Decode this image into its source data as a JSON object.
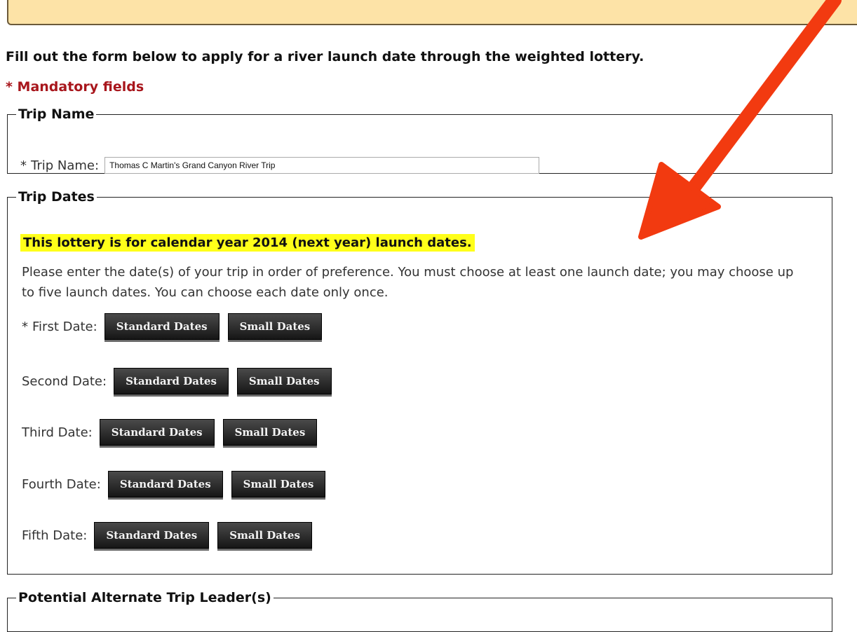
{
  "intro_text": "Fill out the form below to apply for a river launch date through the weighted lottery.",
  "mandatory_note": "* Mandatory fields",
  "trip_name_section": {
    "legend": "Trip Name",
    "required_mark": "*",
    "label": "Trip Name:",
    "value": "Thomas C Martin's Grand Canyon River Trip"
  },
  "trip_dates_section": {
    "legend": "Trip Dates",
    "highlight": "This lottery is for calendar year 2014 (next year) launch dates.",
    "instructions": "Please enter the date(s) of your trip in order of preference. You must choose at least one launch date; you may choose up to five launch dates. You can choose each date only once.",
    "required_mark": "*",
    "rows": [
      {
        "label": "First Date:",
        "standard": "Standard Dates",
        "small": "Small Dates"
      },
      {
        "label": "Second Date:",
        "standard": "Standard Dates",
        "small": "Small Dates"
      },
      {
        "label": "Third Date:",
        "standard": "Standard Dates",
        "small": "Small Dates"
      },
      {
        "label": "Fourth Date:",
        "standard": "Standard Dates",
        "small": "Small Dates"
      },
      {
        "label": "Fifth Date:",
        "standard": "Standard Dates",
        "small": "Small Dates"
      }
    ]
  },
  "alternate_section": {
    "legend": "Potential Alternate Trip Leader(s)"
  },
  "colors": {
    "required": "#a8161c",
    "highlight": "#ffff1a",
    "arrow": "#f23a10",
    "notice_bar": "#fde3a7"
  }
}
